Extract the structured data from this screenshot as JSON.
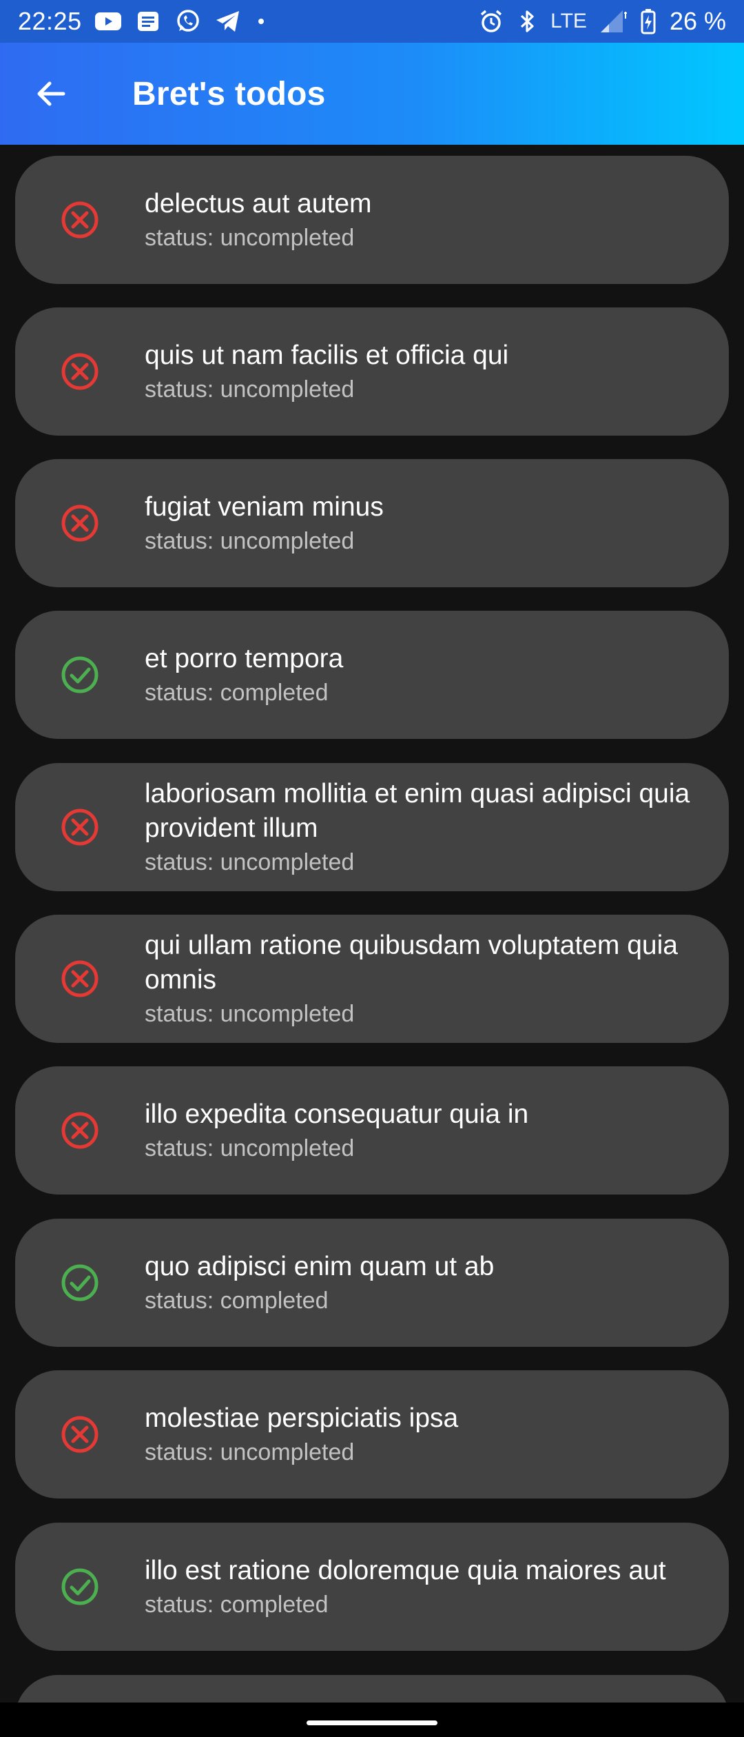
{
  "status_bar": {
    "time": "22:25",
    "notification_icons": [
      "youtube-icon",
      "news-icon",
      "whatsapp-icon",
      "telegram-icon",
      "dot-icon"
    ],
    "system_icons": [
      "alarm-icon",
      "bluetooth-icon",
      "signal-icon",
      "battery-charging-icon"
    ],
    "network": "LTE",
    "battery": "26 %"
  },
  "app_bar": {
    "back_icon": "arrow-back-icon",
    "title": "Bret's todos",
    "gradient_colors": [
      "#2f6bf2",
      "#00c8ff"
    ]
  },
  "status_colors": {
    "completed": "#4caf50",
    "uncompleted": "#e53935"
  },
  "todos": [
    {
      "title": "delectus aut autem",
      "status": "status: uncompleted",
      "completed": false
    },
    {
      "title": "quis ut nam facilis et officia qui",
      "status": "status: uncompleted",
      "completed": false
    },
    {
      "title": "fugiat veniam minus",
      "status": "status: uncompleted",
      "completed": false
    },
    {
      "title": "et porro tempora",
      "status": "status: completed",
      "completed": true
    },
    {
      "title": "laboriosam mollitia et enim quasi adipisci quia provident illum",
      "status": "status: uncompleted",
      "completed": false
    },
    {
      "title": "qui ullam ratione quibusdam voluptatem quia omnis",
      "status": "status: uncompleted",
      "completed": false
    },
    {
      "title": "illo expedita consequatur quia in",
      "status": "status: uncompleted",
      "completed": false
    },
    {
      "title": "quo adipisci enim quam ut ab",
      "status": "status: completed",
      "completed": true
    },
    {
      "title": "molestiae perspiciatis ipsa",
      "status": "status: uncompleted",
      "completed": false
    },
    {
      "title": "illo est ratione doloremque quia maiores aut",
      "status": "status: completed",
      "completed": true
    }
  ]
}
